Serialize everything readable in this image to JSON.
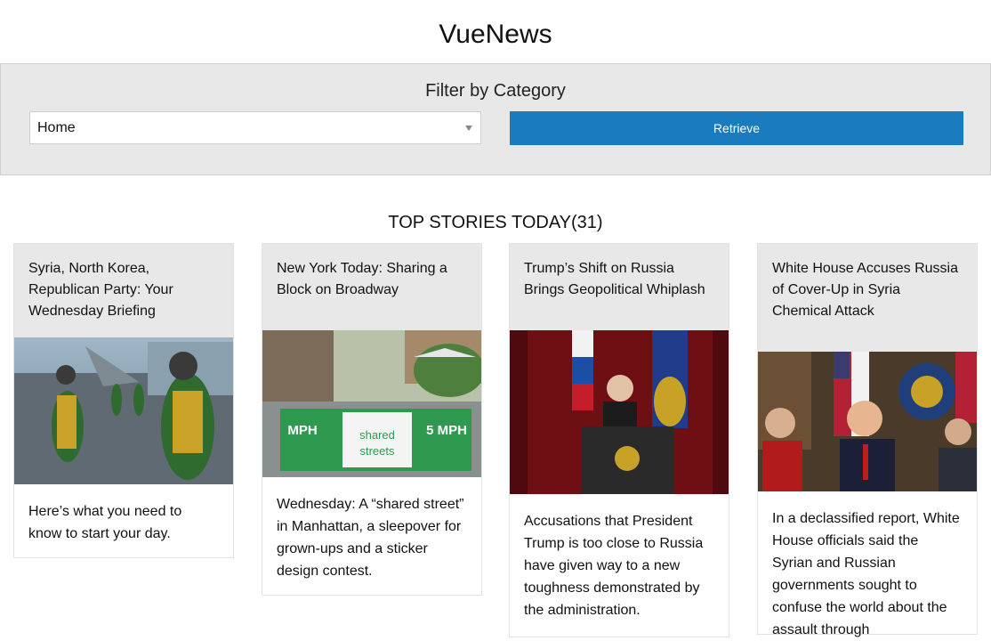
{
  "app": {
    "title": "VueNews"
  },
  "filter": {
    "heading": "Filter by Category",
    "selected_category": "Home",
    "retrieve_label": "Retrieve"
  },
  "stories": {
    "heading": "TOP STORIES TODAY(31)",
    "items": [
      {
        "title": "Syria, North Korea, Republican Party: Your Wednesday Briefing",
        "abstract": "Here’s what you need to know to start your day.",
        "image": "sailors-on-aircraft-carrier-deck"
      },
      {
        "title": "New York Today: Sharing a Block on Broadway",
        "abstract": "Wednesday: A “shared street” in Manhattan, a sleepover for grown-ups and a sticker design contest.",
        "image": "shared-streets-broadway",
        "image_texts": {
          "left": "MPH",
          "center_top": "shared",
          "center_bottom": "streets",
          "right": "5 MPH"
        }
      },
      {
        "title": "Trump’s Shift on Russia Brings Geopolitical Whiplash",
        "abstract": "Accusations that President Trump is too close to Russia have given way to a new toughness demonstrated by the administration.",
        "image": "putin-at-podium"
      },
      {
        "title": "White House Accuses Russia of Cover-Up in Syria Chemical Attack",
        "abstract": "In a declassified report, White House officials said the Syrian and Russian governments sought to confuse the world about the assault through",
        "image": "trump-at-meeting"
      }
    ]
  }
}
